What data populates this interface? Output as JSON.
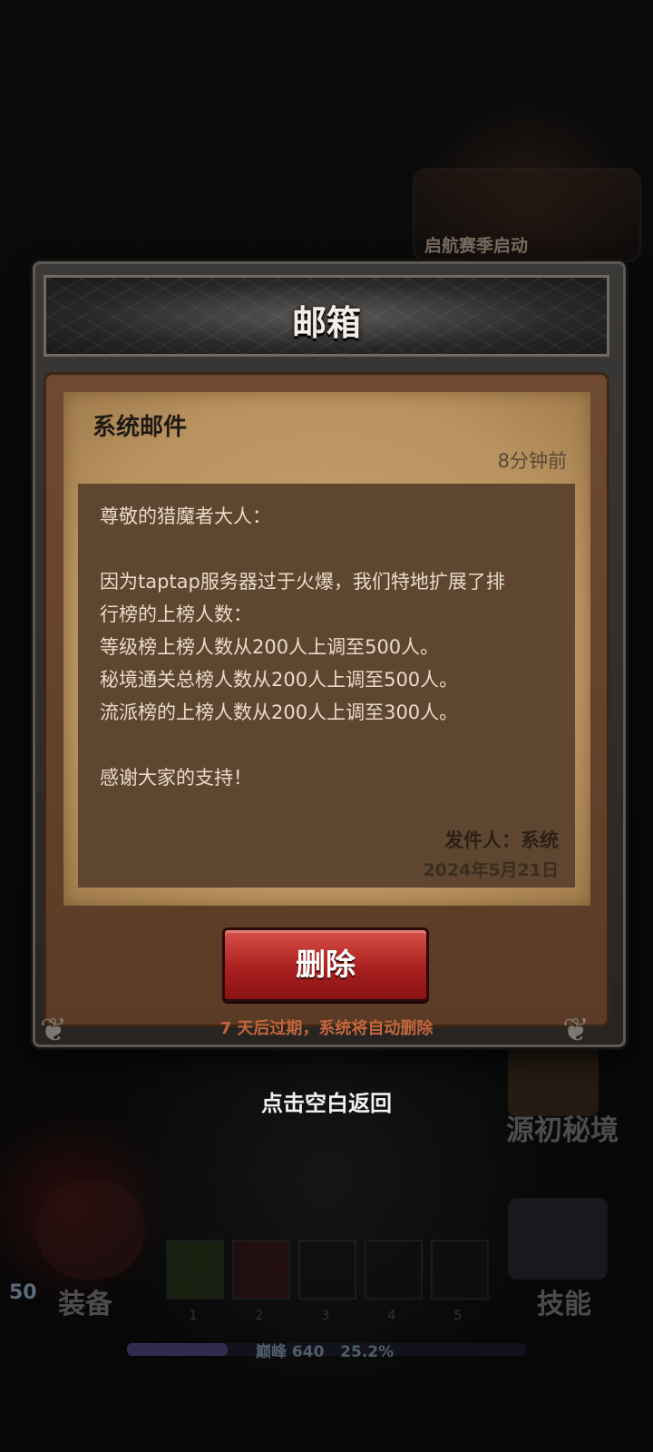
{
  "background": {
    "season_label": "启航赛季启动",
    "realm_label": "源初秘境",
    "equip_label": "装备",
    "skill_label": "技能",
    "player_level": "50",
    "slot_numbers": [
      "1",
      "2",
      "3",
      "4",
      "5"
    ],
    "peak_text": "巅峰 640",
    "peak_percent_text": "25.2%",
    "peak_progress": 0.252
  },
  "modal": {
    "title": "邮箱",
    "mail": {
      "title": "系统邮件",
      "time_ago": "8分钟前",
      "lines": [
        "尊敬的猎魔者大人：",
        "",
        "因为taptap服务器过于火爆，我们特地扩展了排",
        "行榜的上榜人数：",
        "等级榜上榜人数从200人上调至500人。",
        "秘境通关总榜人数从200人上调至500人。",
        "流派榜的上榜人数从200人上调至300人。",
        "",
        "感谢大家的支持！"
      ],
      "sender": "发件人：系统",
      "date": "2024年5月21日"
    },
    "delete_label": "删除",
    "expire_note": "7 天后过期，系统将自动删除"
  },
  "tap_return_label": "点击空白返回",
  "colors": {
    "accent_red": "#a9201f",
    "parchment": "#b8925f",
    "expire_note": "#c2663e"
  }
}
